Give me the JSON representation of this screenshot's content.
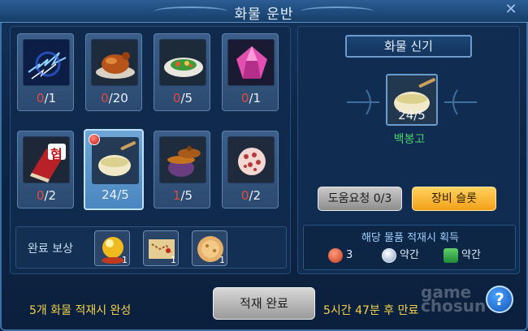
{
  "title": "화물 운반",
  "slots": [
    {
      "have": "0",
      "need": "/1",
      "icon": "lightning-icon"
    },
    {
      "have": "0",
      "need": "/20",
      "icon": "roast-meat-icon"
    },
    {
      "have": "0",
      "need": "/5",
      "icon": "salad-plate-icon"
    },
    {
      "have": "0",
      "need": "/1",
      "icon": "pink-gem-icon"
    },
    {
      "have": "0",
      "need": "/2",
      "icon": "red-book-icon",
      "label": "협"
    },
    {
      "have": "24",
      "need": "/5",
      "icon": "soup-bowl-icon"
    },
    {
      "have": "1",
      "need": "/5",
      "icon": "clay-pot-icon"
    },
    {
      "have": "0",
      "need": "/2",
      "icon": "coral-icon"
    }
  ],
  "reward": {
    "label": "완료 보상",
    "items": [
      {
        "icon": "gold-orb-icon",
        "qty": "1"
      },
      {
        "icon": "treasure-map-icon",
        "qty": "1"
      },
      {
        "icon": "pancake-icon",
        "qty": "1"
      }
    ]
  },
  "right": {
    "header": "화물 신기",
    "big_count": "24/5",
    "item_name": "백봉고",
    "help_button": "도움요청 0/3",
    "equip_button": "장비 슬롯",
    "info_title": "해당 물품 적재시 획득",
    "currencies": [
      {
        "icon": "red-coin-icon",
        "text": "3"
      },
      {
        "icon": "silver-coin-icon",
        "text": "약간"
      },
      {
        "icon": "green-ticket-icon",
        "text": "약간"
      }
    ]
  },
  "footer": {
    "left_text": "5개 화물 적재시 완성",
    "main_button": "적재 완료",
    "right_text": "5시간 47분 후 만료",
    "help_label": "?",
    "watermark": "game chosun"
  },
  "colors": {
    "missing": "#e14b3e",
    "name_green": "#4bd06a",
    "accent_yellow": "#f5d24a"
  }
}
